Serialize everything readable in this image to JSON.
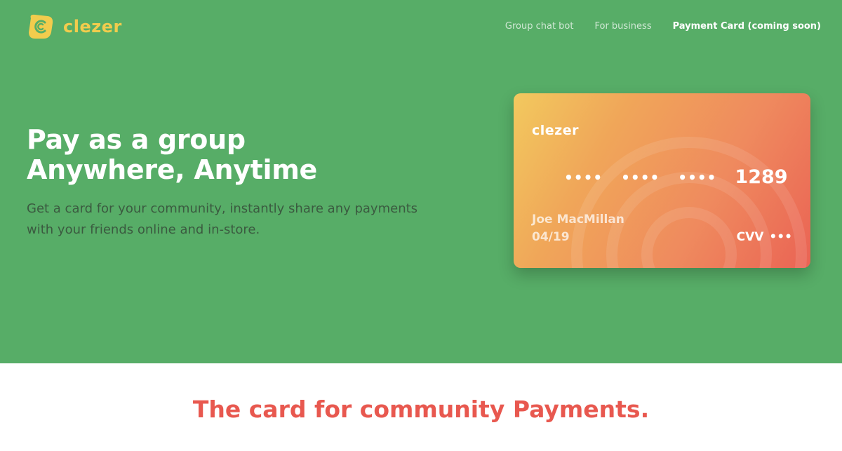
{
  "header": {
    "logo_text": "clezer",
    "nav": [
      {
        "label": "Group chat bot"
      },
      {
        "label": "For business"
      },
      {
        "label": "Payment Card (coming soon)"
      }
    ]
  },
  "hero": {
    "headline_line1": "Pay as a group",
    "headline_line2": "Anywhere, Anytime",
    "subtext": "Get a card for your community, instantly share any payments with your friends online and in-store."
  },
  "card": {
    "logo_text": "clezer",
    "number_groups": [
      "••••",
      "••••",
      "••••"
    ],
    "last4": "1289",
    "holder_name": "Joe MacMillan",
    "expiry": "04/19",
    "cvv_label": "CVV",
    "cvv_value": "•••"
  },
  "section": {
    "title": "The card for community Payments."
  },
  "colors": {
    "hero_bg": "#57ad67",
    "brand_yellow": "#f2cc4d",
    "accent_red": "#e8584f"
  }
}
